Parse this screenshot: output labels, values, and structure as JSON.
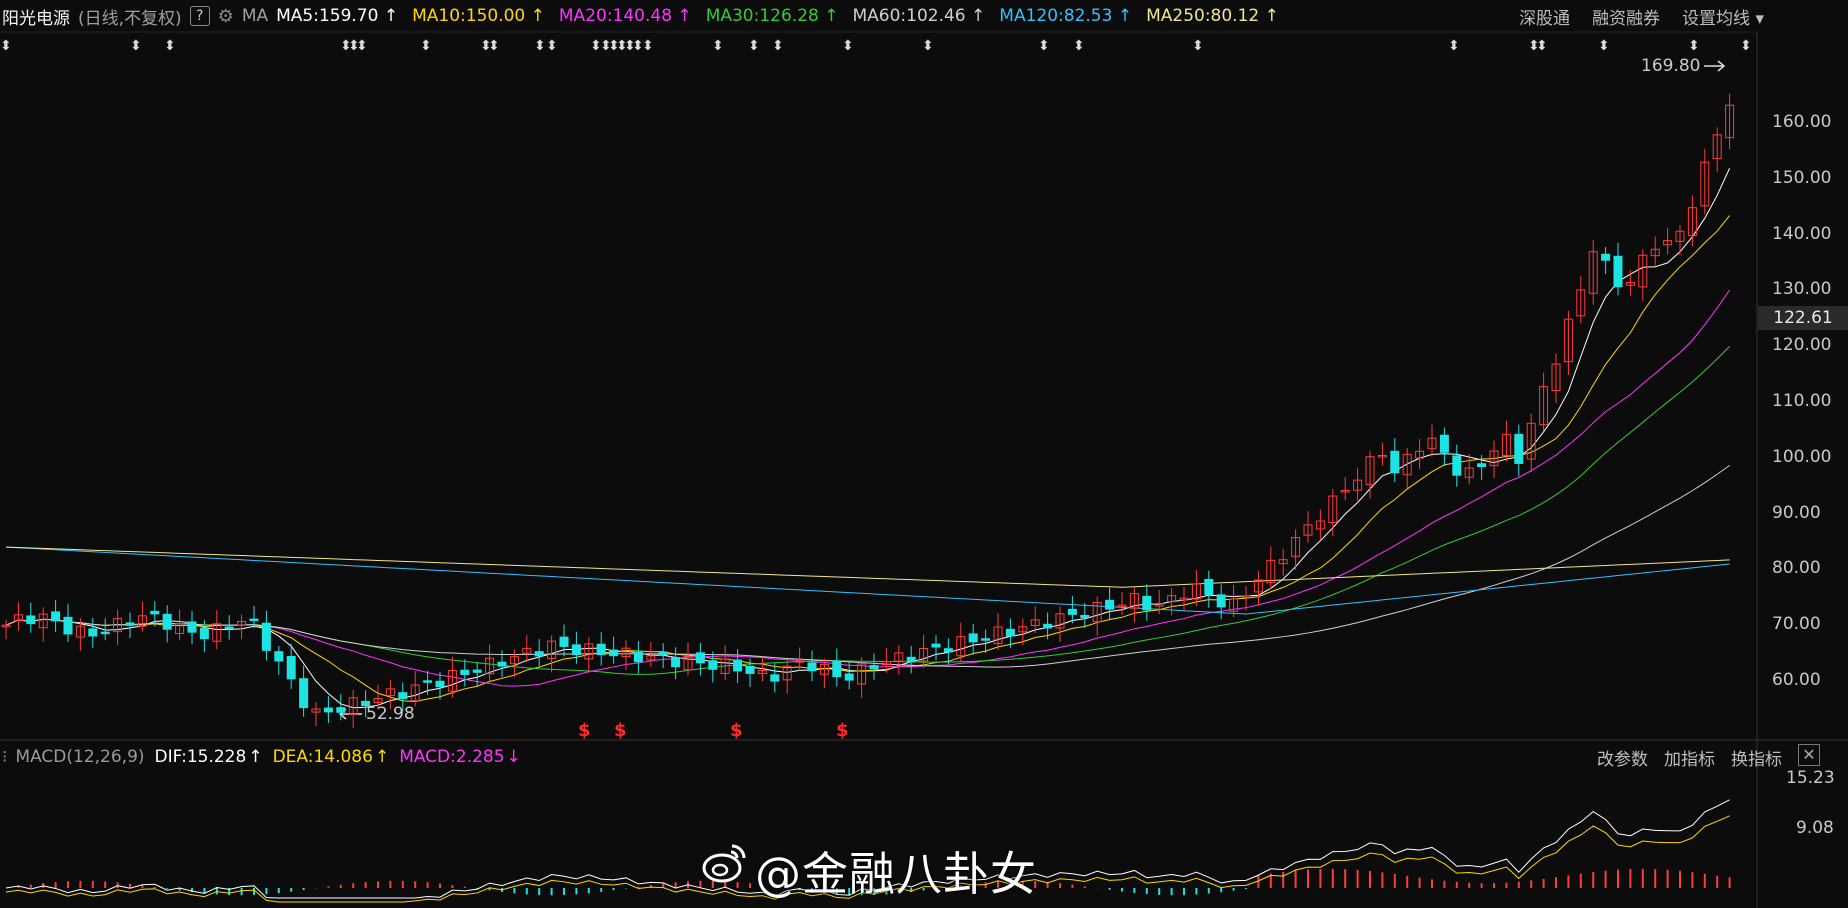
{
  "header": {
    "stock_name": "阳光电源",
    "mode": "(日线,不复权)",
    "help": "?",
    "indicator_name": "MA",
    "ma": [
      {
        "label": "MA5:159.70",
        "arrow": "↑",
        "color": "#ffffff"
      },
      {
        "label": "MA10:150.00",
        "arrow": "↑",
        "color": "#ffd700"
      },
      {
        "label": "MA20:140.48",
        "arrow": "↑",
        "color": "#ff33ff"
      },
      {
        "label": "MA30:126.28",
        "arrow": "↑",
        "color": "#33cc33"
      },
      {
        "label": "MA60:102.46",
        "arrow": "↑",
        "color": "#d0d0d0"
      },
      {
        "label": "MA120:82.53",
        "arrow": "↑",
        "color": "#33c0ff"
      },
      {
        "label": "MA250:80.12",
        "arrow": "↑",
        "color": "#f0e68c"
      }
    ],
    "links": [
      "深股通",
      "融资融券",
      "设置均线 ▾"
    ]
  },
  "price_axis": {
    "ticks": [
      "160.00",
      "150.00",
      "140.00",
      "130.00",
      "120.00",
      "110.00",
      "100.00",
      "90.00",
      "80.00",
      "70.00",
      "60.00"
    ],
    "last_price": "122.61"
  },
  "annotations": {
    "high_label": "169.80",
    "low_label": "52.98"
  },
  "macd": {
    "name": "MACD(12,26,9)",
    "dif": "DIF:15.228",
    "dif_arrow": "↑",
    "dea": "DEA:14.086",
    "dea_arrow": "↑",
    "macd": "MACD:2.285",
    "macd_arrow": "↓",
    "buttons": [
      "改参数",
      "加指标",
      "换指标"
    ],
    "close": "✕",
    "axis_ticks": [
      "15.23",
      "9.08"
    ],
    "colors": {
      "dif": "#ffffff",
      "dea": "#ffd700",
      "macd": "#ff33ff"
    }
  },
  "watermark": "@金融八卦女",
  "colors": {
    "up": "#ff3b3b",
    "down": "#1ee3e3",
    "background": "#0c0c0d"
  }
}
